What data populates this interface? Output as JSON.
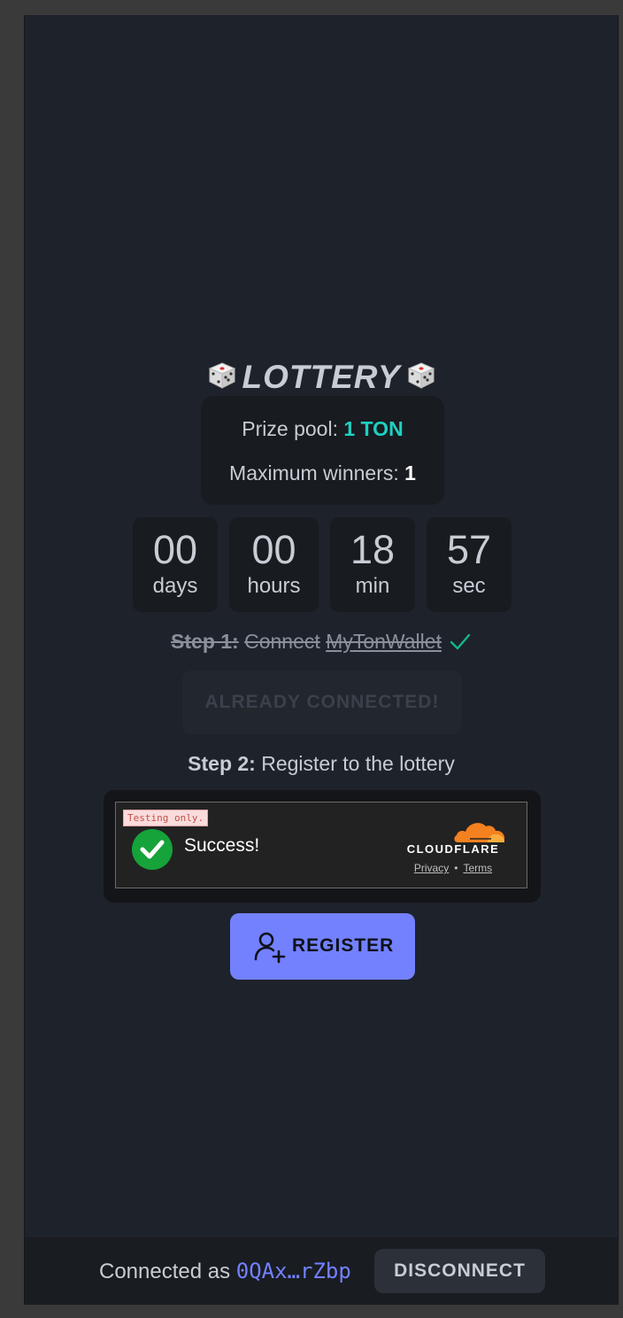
{
  "header": {
    "title": "LOTTERY",
    "dice_icon": "game-die-icon"
  },
  "prize": {
    "pool_label": "Prize pool:",
    "pool_value": "1 TON",
    "winners_label": "Maximum winners:",
    "winners_value": "1",
    "pool_color": "#1dd1c1"
  },
  "countdown": {
    "days": {
      "value": "00",
      "unit": "days"
    },
    "hours": {
      "value": "00",
      "unit": "hours"
    },
    "minutes": {
      "value": "18",
      "unit": "min"
    },
    "seconds": {
      "value": "57",
      "unit": "sec"
    }
  },
  "step1": {
    "label": "Step 1:",
    "text": "Connect",
    "link": "MyTonWallet",
    "completed_icon": "check-icon",
    "button_label": "ALREADY CONNECTED!"
  },
  "step2": {
    "label": "Step 2:",
    "text": "Register to the lottery"
  },
  "captcha": {
    "testing_badge": "Testing only.",
    "status": "Success!",
    "brand": "CLOUDFLARE",
    "privacy": "Privacy",
    "separator": "•",
    "terms": "Terms"
  },
  "register": {
    "button_label": "REGISTER",
    "icon": "add-user-icon",
    "accent": "#7381ff"
  },
  "footer": {
    "connected_label": "Connected as",
    "address": "0QAx…rZbp",
    "disconnect_label": "DISCONNECT"
  }
}
